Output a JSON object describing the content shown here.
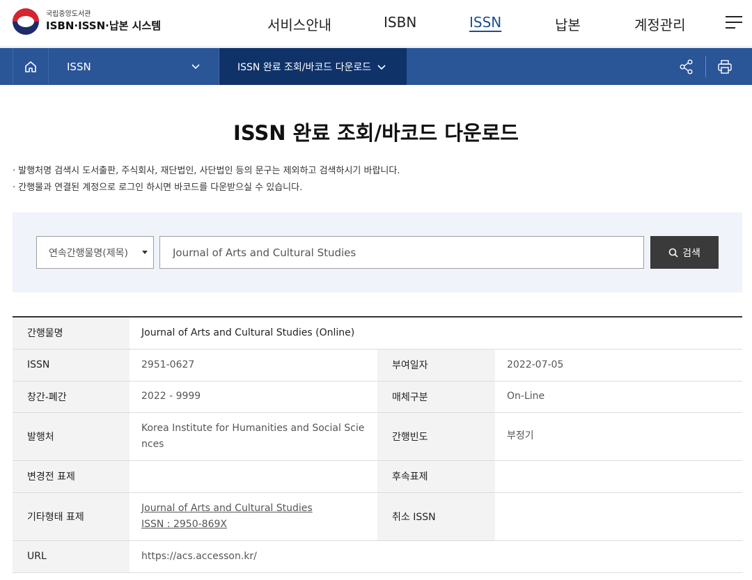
{
  "header": {
    "logo_sub": "국립중앙도서관",
    "logo_main": "ISBN·ISSN·납본 시스템",
    "nav": [
      "서비스안내",
      "ISBN",
      "ISSN",
      "납본",
      "계정관리"
    ],
    "active_nav": "ISSN"
  },
  "locbar": {
    "level1": "ISSN",
    "level2": "ISSN 완료 조회/바코드 다운로드"
  },
  "page": {
    "title": "ISSN 완료 조회/바코드 다운로드",
    "notice1": "· 발행처명 검색시 도서출판, 주식회사, 재단법인, 사단법인 등의 문구는 제외하고 검색하시기 바랍니다.",
    "notice2": "· 간행물과 연결된 계정으로 로그인 하시면 바코드를 다운받으실 수 있습니다."
  },
  "search": {
    "select_value": "연속간행물명(제목)",
    "input_value": "Journal of Arts and Cultural Studies",
    "button_label": "검색"
  },
  "table": {
    "title_label": "간행물명",
    "title_value": "Journal of Arts and Cultural Studies (Online)",
    "issn_label": "ISSN",
    "issn_value": "2951-0627",
    "assign_date_label": "부여일자",
    "assign_date_value": "2022-07-05",
    "period_label": "창간-폐간",
    "period_value": "2022 - 9999",
    "media_label": "매체구분",
    "media_value": "On-Line",
    "publisher_label": "발행처",
    "publisher_value_line1": "Korea Institute for Humanities and Social Scie",
    "publisher_value_line2": "nces",
    "frequency_label": "간행빈도",
    "frequency_value": "부정기",
    "prev_title_label": "변경전 표제",
    "prev_title_value": "",
    "next_title_label": "후속표제",
    "next_title_value": "",
    "other_form_label": "기타형태 표제",
    "other_form_line1": "Journal of Arts and Cultural Studies",
    "other_form_line2": "ISSN : 2950-869X",
    "cancel_issn_label": "취소 ISSN",
    "cancel_issn_value": "",
    "url_label": "URL",
    "url_value": "https://acs.accesson.kr/"
  }
}
